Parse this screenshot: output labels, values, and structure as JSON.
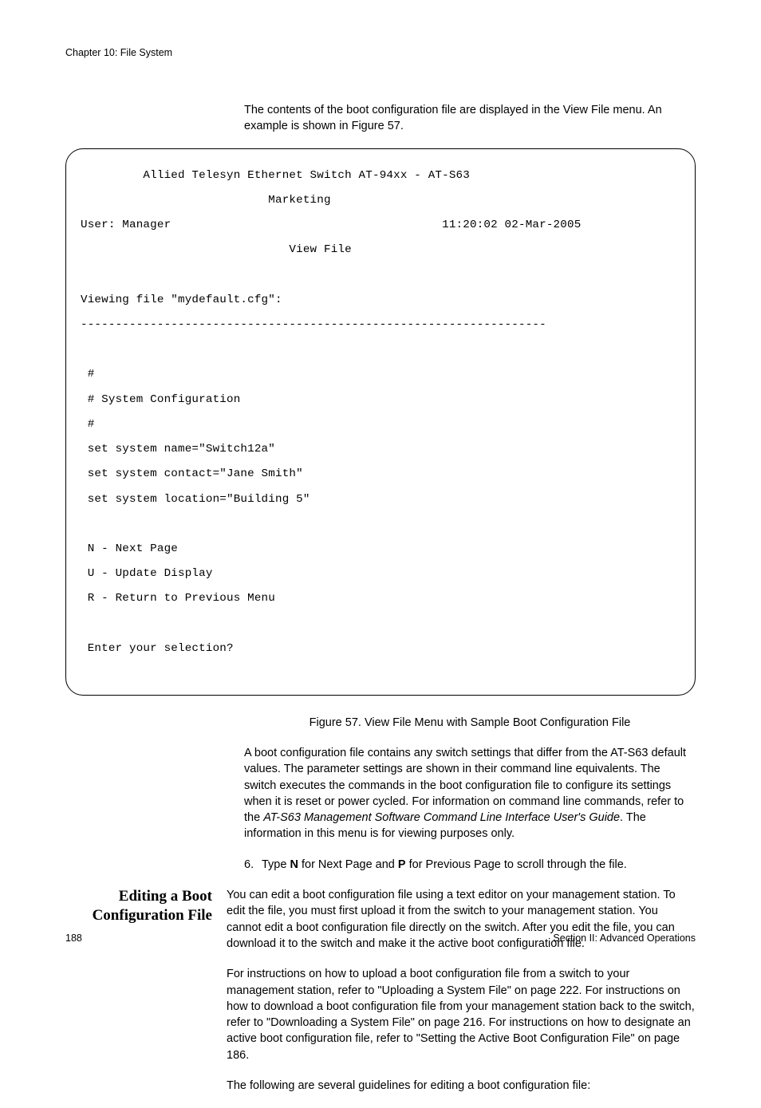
{
  "header": {
    "chapter": "Chapter 10: File System"
  },
  "intro_para": "The contents of the boot configuration file are displayed in the View File menu. An example is shown in Figure 57.",
  "terminal": {
    "title_line": "         Allied Telesyn Ethernet Switch AT-94xx - AT-S63",
    "subtitle_line": "                           Marketing",
    "user_label": "User: Manager",
    "datetime": "11:20:02 02-Mar-2005",
    "screen_name": "                              View File",
    "viewing_label": "Viewing file \"mydefault.cfg\":",
    "hr": "-------------------------------------------------------------------",
    "cfg": [
      " #",
      " # System Configuration",
      " #",
      " set system name=\"Switch12a\"",
      " set system contact=\"Jane Smith\"",
      " set system location=\"Building 5\""
    ],
    "menu": [
      " N - Next Page",
      " U - Update Display",
      " R - Return to Previous Menu"
    ],
    "prompt": " Enter your selection?"
  },
  "figure_caption": "Figure 57. View File Menu with Sample Boot Configuration File",
  "para_after_fig_1": "A boot configuration file contains any switch settings that differ from the AT-S63 default values. The parameter settings are shown in their command line equivalents. The switch executes the commands in the boot configuration file to configure its settings when it is reset or power cycled. For information on command line commands, refer to the ",
  "para_after_fig_1_italic": "AT-S63 Management Software Command Line Interface User's Guide",
  "para_after_fig_1_tail": ". The information in this menu is for viewing purposes only.",
  "step6": {
    "num": "6.",
    "pre": "Type ",
    "b1": "N",
    "mid1": " for Next Page and ",
    "b2": "P",
    "mid2": " for Previous Page to scroll through the file."
  },
  "side_heading": "Editing a Boot Configuration File",
  "edit_para1": "You can edit a boot configuration file using a text editor on your management station. To edit the file, you must first upload it from the switch to your management station. You cannot edit a boot configuration file directly on the switch. After you edit the file, you can download it to the switch and make it the active boot configuration file.",
  "edit_para2": "For instructions on how to upload a boot configuration file from a switch to your management station, refer to \"Uploading a System File\" on page 222. For instructions on how to download a boot configuration file from your management station back to the switch, refer to \"Downloading a System File\" on page 216. For instructions on how to designate an active boot configuration file, refer to \"Setting the Active Boot Configuration File\" on page 186.",
  "edit_para3": "The following are several guidelines for editing a boot configuration file:",
  "footer": {
    "page": "188",
    "section": "Section II: Advanced Operations"
  }
}
